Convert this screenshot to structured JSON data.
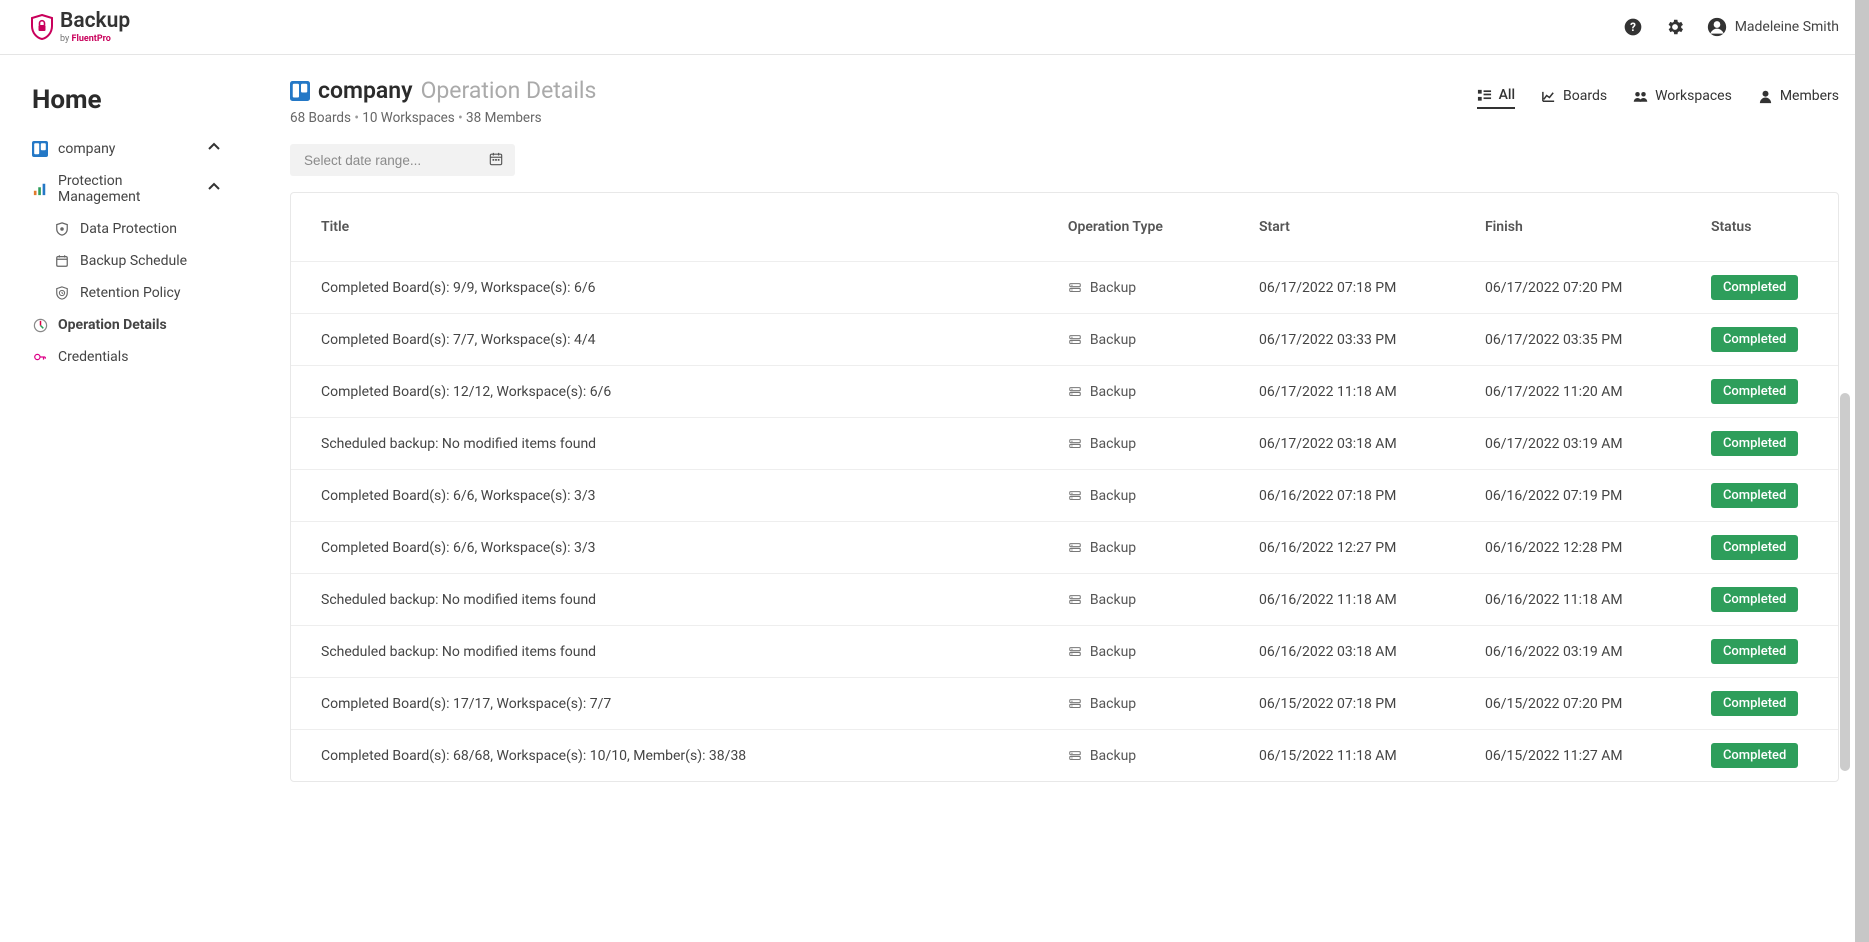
{
  "header": {
    "brand_main": "Backup",
    "brand_sub_prefix": "by ",
    "brand_sub_bold": "FluentPro",
    "user_name": "Madeleine Smith"
  },
  "sidebar": {
    "home": "Home",
    "org": "company",
    "protection_mgmt": "Protection Management",
    "data_protection": "Data Protection",
    "backup_schedule": "Backup Schedule",
    "retention_policy": "Retention Policy",
    "operation_details": "Operation Details",
    "credentials": "Credentials"
  },
  "page": {
    "org": "company",
    "section": "Operation Details",
    "meta_boards": "68 Boards",
    "meta_workspaces": "10 Workspaces",
    "meta_members": "38 Members"
  },
  "tabs": {
    "all": "All",
    "boards": "Boards",
    "workspaces": "Workspaces",
    "members": "Members"
  },
  "filter": {
    "placeholder": "Select date range..."
  },
  "table": {
    "headers": {
      "title": "Title",
      "op_type": "Operation Type",
      "start": "Start",
      "finish": "Finish",
      "status": "Status"
    },
    "op_label": "Backup",
    "status_label": "Completed",
    "rows": [
      {
        "title": "Completed Board(s): 9/9, Workspace(s): 6/6",
        "start": "06/17/2022 07:18 PM",
        "finish": "06/17/2022 07:20 PM"
      },
      {
        "title": "Completed Board(s): 7/7, Workspace(s): 4/4",
        "start": "06/17/2022 03:33 PM",
        "finish": "06/17/2022 03:35 PM"
      },
      {
        "title": "Completed Board(s): 12/12, Workspace(s): 6/6",
        "start": "06/17/2022 11:18 AM",
        "finish": "06/17/2022 11:20 AM"
      },
      {
        "title": "Scheduled backup: No modified items found",
        "start": "06/17/2022 03:18 AM",
        "finish": "06/17/2022 03:19 AM"
      },
      {
        "title": "Completed Board(s): 6/6, Workspace(s): 3/3",
        "start": "06/16/2022 07:18 PM",
        "finish": "06/16/2022 07:19 PM"
      },
      {
        "title": "Completed Board(s): 6/6, Workspace(s): 3/3",
        "start": "06/16/2022 12:27 PM",
        "finish": "06/16/2022 12:28 PM"
      },
      {
        "title": "Scheduled backup: No modified items found",
        "start": "06/16/2022 11:18 AM",
        "finish": "06/16/2022 11:18 AM"
      },
      {
        "title": "Scheduled backup: No modified items found",
        "start": "06/16/2022 03:18 AM",
        "finish": "06/16/2022 03:19 AM"
      },
      {
        "title": "Completed Board(s): 17/17, Workspace(s): 7/7",
        "start": "06/15/2022 07:18 PM",
        "finish": "06/15/2022 07:20 PM"
      },
      {
        "title": "Completed Board(s): 68/68, Workspace(s): 10/10, Member(s): 38/38",
        "start": "06/15/2022 11:18 AM",
        "finish": "06/15/2022 11:27 AM"
      }
    ]
  }
}
